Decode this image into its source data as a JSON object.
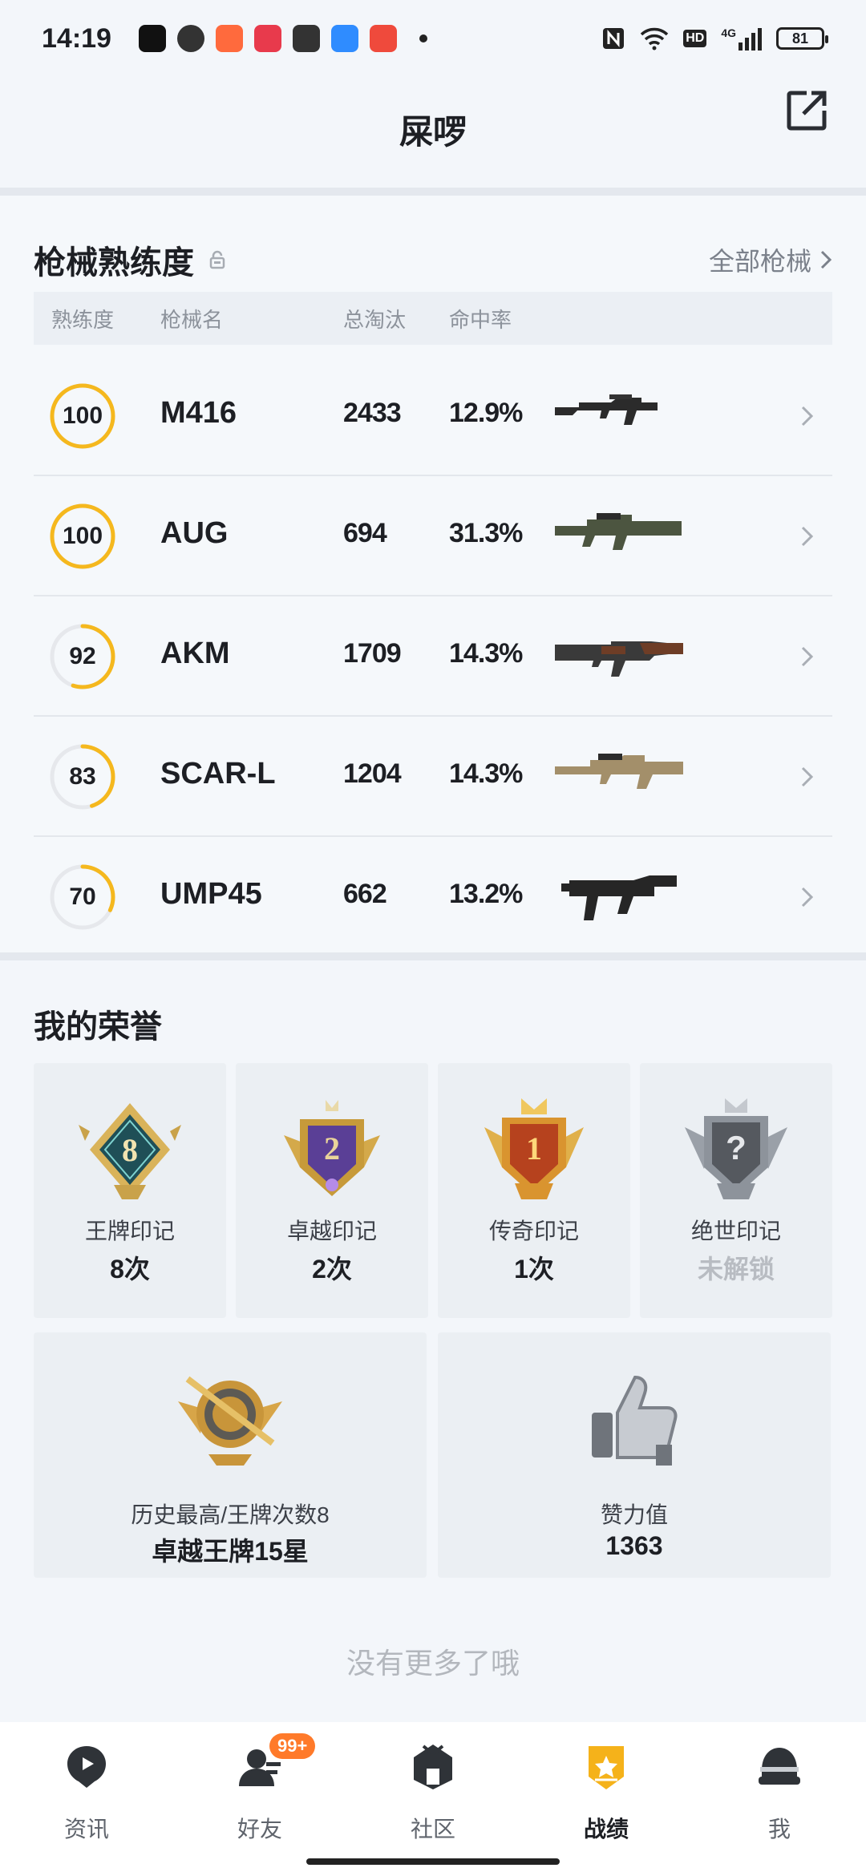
{
  "status_bar": {
    "time": "14:19",
    "app_icons": [
      {
        "name": "tiktok-icon",
        "color": "#111111"
      },
      {
        "name": "wechat-icon",
        "color": "#222222"
      },
      {
        "name": "mail-icon",
        "color": "#ff6a3d"
      },
      {
        "name": "music-icon",
        "color": "#e83a4c"
      },
      {
        "name": "alipay-icon",
        "color": "#222222"
      },
      {
        "name": "files-icon",
        "color": "#2f8cff"
      },
      {
        "name": "video-icon",
        "color": "#ef4a3c"
      }
    ],
    "network": "4G",
    "hd": "HD",
    "battery": "81"
  },
  "header": {
    "title": "屎啰"
  },
  "weapons": {
    "title": "枪械熟练度",
    "all_link": "全部枪械",
    "columns": {
      "mastery": "熟练度",
      "name": "枪械名",
      "kills": "总淘汰",
      "hit_rate": "命中率"
    },
    "rows": [
      {
        "mastery": "100",
        "mastery_ratio": 1.0,
        "name": "M416",
        "kills": "2433",
        "hit_rate": "12.9%",
        "icon": "m416-rifle-image"
      },
      {
        "mastery": "100",
        "mastery_ratio": 1.0,
        "name": "AUG",
        "kills": "694",
        "hit_rate": "31.3%",
        "icon": "aug-rifle-image"
      },
      {
        "mastery": "92",
        "mastery_ratio": 0.55,
        "name": "AKM",
        "kills": "1709",
        "hit_rate": "14.3%",
        "icon": "akm-rifle-image"
      },
      {
        "mastery": "83",
        "mastery_ratio": 0.45,
        "name": "SCAR-L",
        "kills": "1204",
        "hit_rate": "14.3%",
        "icon": "scar-rifle-image"
      },
      {
        "mastery": "70",
        "mastery_ratio": 0.32,
        "name": "UMP45",
        "kills": "662",
        "hit_rate": "13.2%",
        "icon": "ump45-smg-image"
      }
    ]
  },
  "honors": {
    "title": "我的荣誉",
    "badges": [
      {
        "label": "王牌印记",
        "value": "8次",
        "icon": "ace-badge-icon",
        "badge_text": "8"
      },
      {
        "label": "卓越印记",
        "value": "2次",
        "icon": "excellence-badge-icon",
        "badge_text": "2"
      },
      {
        "label": "传奇印记",
        "value": "1次",
        "icon": "legend-badge-icon",
        "badge_text": "1"
      },
      {
        "label": "绝世印记",
        "value": "未解锁",
        "icon": "locked-badge-icon",
        "badge_text": "?"
      }
    ],
    "highest": {
      "label": "历史最高/王牌次数8",
      "value": "卓越王牌15星",
      "icon": "rank-emblem-icon"
    },
    "likes": {
      "label": "赞力值",
      "value": "1363",
      "icon": "thumbs-up-icon"
    },
    "no_more": "没有更多了哦"
  },
  "nav": {
    "items": [
      {
        "label": "资讯",
        "icon": "news-icon"
      },
      {
        "label": "好友",
        "icon": "friends-icon",
        "badge": "99+"
      },
      {
        "label": "社区",
        "icon": "community-icon"
      },
      {
        "label": "战绩",
        "icon": "record-icon",
        "active": true
      },
      {
        "label": "我",
        "icon": "profile-icon"
      }
    ]
  }
}
